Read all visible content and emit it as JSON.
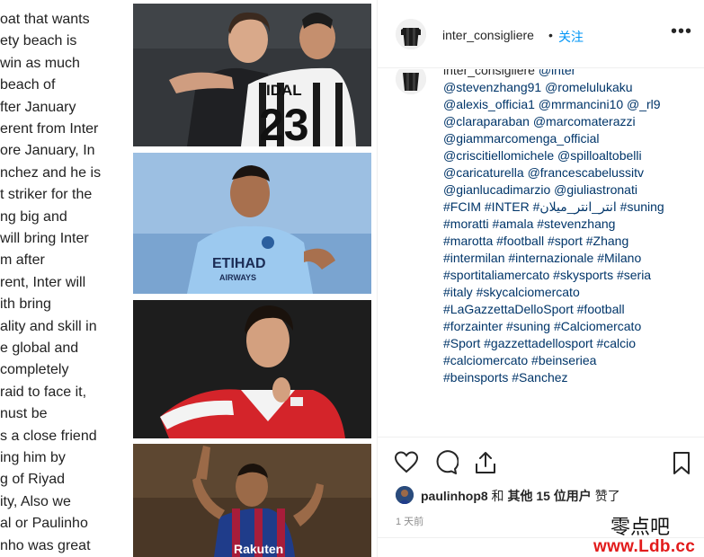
{
  "left_text": [
    "oat that wants",
    "ety beach is",
    "win as much",
    "beach of",
    "fter January",
    "erent from Inter",
    "ore January, In",
    "nchez and he is",
    "t striker for the",
    "ng big and",
    "will bring Inter",
    "m after",
    "rent, Inter will",
    "ith bring",
    "ality and skill in",
    "e global and",
    "completely",
    "raid to face it,",
    "nust be",
    "s a close friend",
    "ing him by",
    "g of Riyad",
    "ity, Also we",
    "al or Paulinho",
    "nho was great"
  ],
  "photos": [
    {
      "name": "player-photo-vidal",
      "jersey_name": "IDAL",
      "jersey_number": "23"
    },
    {
      "name": "player-photo-mahrez",
      "sponsor_top": "ETIHAD",
      "sponsor_bottom": "AIRWAYS"
    },
    {
      "name": "player-photo-ozil"
    },
    {
      "name": "player-photo-paulinho",
      "sponsor": "Rakuten"
    }
  ],
  "post": {
    "username": "inter_consigliere",
    "separator": "•",
    "follow_label": "关注",
    "more_label": "•••",
    "caption_lines": [
      {
        "user": "inter_consigliere",
        "text": " @inter"
      },
      {
        "text": "@stevenzhang91 @romelulukaku"
      },
      {
        "text": "@alexis_officia1 @mrmancini10 @_rl9"
      },
      {
        "text": "@claraparaban @marcomaterazzi"
      },
      {
        "text": "@giammarcomenga_official"
      },
      {
        "text": "@criscitiellomichele @spilloaltobelli"
      },
      {
        "text": "@caricaturella @francescabelussitv"
      },
      {
        "text": "@gianlucadimarzio @giuliastronati"
      },
      {
        "text": "#FCIM #INTER #انتر_انتر_ميلان #suning"
      },
      {
        "text": "#moratti #amala #stevenzhang"
      },
      {
        "text": "#marotta #football #sport #Zhang"
      },
      {
        "text": "#intermilan #internazionale #Milano"
      },
      {
        "text": "#sportitaliamercato #skysports #seria"
      },
      {
        "text": "#italy #skycalciomercato"
      },
      {
        "text": "#LaGazzettaDelloSport #football"
      },
      {
        "text": "#forzainter #suning #Calciomercato"
      },
      {
        "text": "#Sport #gazzettadellosport #calcio"
      },
      {
        "text": "#calciomercato #beinseriea"
      },
      {
        "text": "#beinsports #Sanchez"
      }
    ],
    "age": "1 天",
    "liked_by": "paulinhop8",
    "likes_and": " 和 ",
    "likes_others": "其他 15 位用户",
    "likes_suffix": " 赞了",
    "time": "1 天前"
  },
  "watermark": {
    "line1": "零点吧",
    "line2": "www.Ldb.cc"
  },
  "colors": {
    "link": "#003569",
    "follow": "#0095f6",
    "muted": "#8e8e8e",
    "watermark_red": "#e21b1b"
  }
}
